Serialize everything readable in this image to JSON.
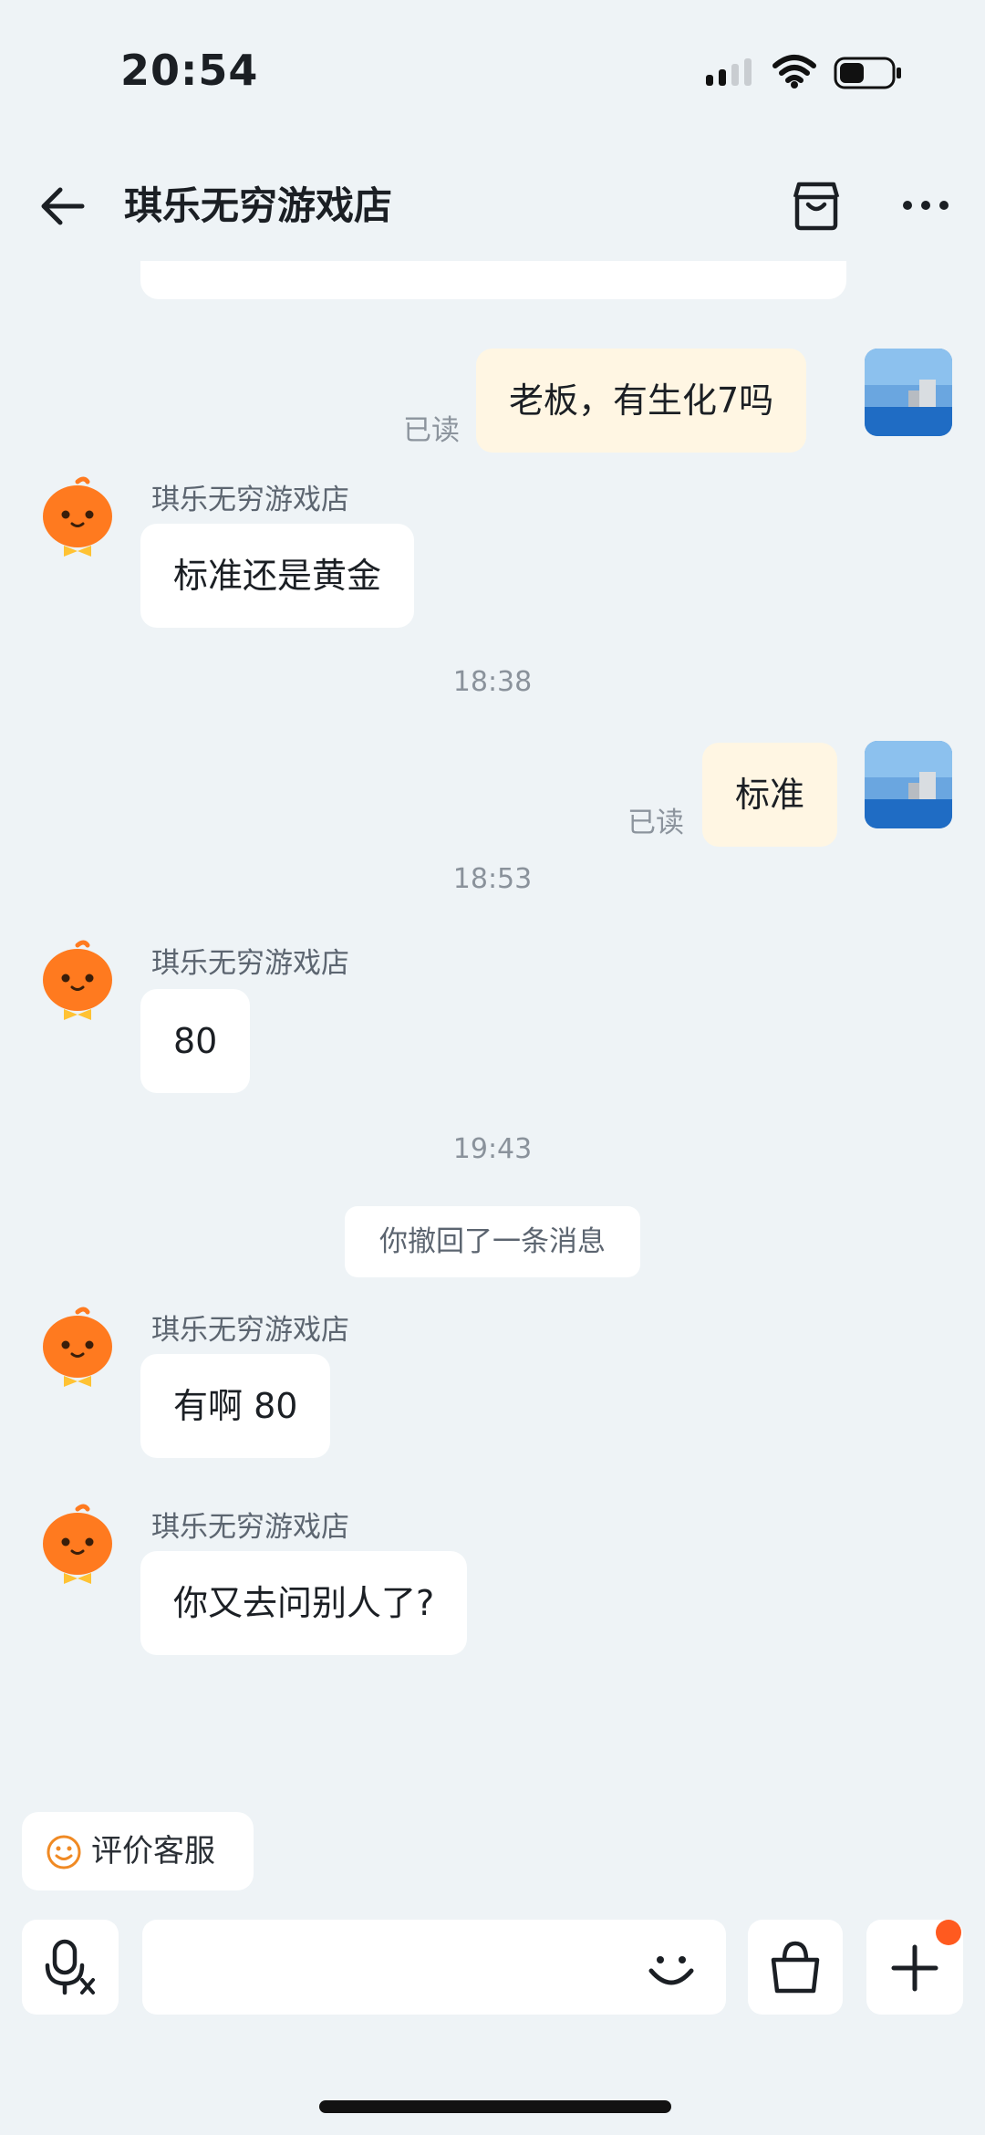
{
  "status_bar": {
    "time": "20:54"
  },
  "header": {
    "title": "琪乐无穷游戏店"
  },
  "messages": [
    {
      "side": "out",
      "text": "老板，有生化7吗",
      "read_label": "已读"
    },
    {
      "side": "in",
      "sender": "琪乐无穷游戏店",
      "text": "标准还是黄金"
    },
    {
      "timestamp": "18:38"
    },
    {
      "side": "out",
      "text": "标准",
      "read_label": "已读"
    },
    {
      "timestamp": "18:53"
    },
    {
      "side": "in",
      "sender": "琪乐无穷游戏店",
      "text": "80"
    },
    {
      "timestamp": "19:43"
    },
    {
      "system": "你撤回了一条消息"
    },
    {
      "side": "in",
      "sender": "琪乐无穷游戏店",
      "text": "有啊 80"
    },
    {
      "side": "in",
      "sender": "琪乐无穷游戏店",
      "text": "你又去问别人了?"
    }
  ],
  "rate_chip": {
    "label": "评价客服"
  },
  "input_bar": {
    "placeholder": ""
  },
  "colors": {
    "background": "#eef3f6",
    "outgoing_bubble": "#fff6e3",
    "incoming_bubble": "#ffffff",
    "shop_avatar": "#ff7a1f",
    "notification_dot": "#ff5a1f"
  },
  "icons": {
    "back": "arrow-left-icon",
    "store": "store-icon",
    "more": "more-dots-icon",
    "voice": "voice-to-text-icon",
    "emoji": "smile-icon",
    "shopping": "shopping-bag-icon",
    "plus": "plus-icon"
  }
}
